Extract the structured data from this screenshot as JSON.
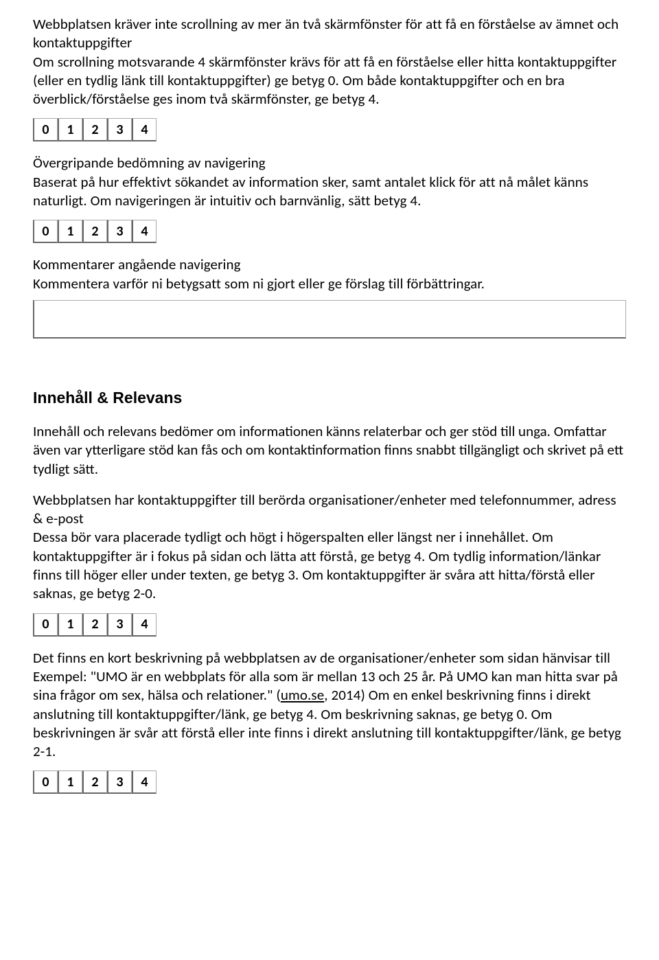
{
  "ratings": {
    "r0": "0",
    "r1": "1",
    "r2": "2",
    "r3": "3",
    "r4": "4"
  },
  "q1": {
    "title": "Webbplatsen kräver inte scrollning av mer än två skärmfönster för att få en förståelse av ämnet och kontaktuppgifter",
    "desc": "Om scrollning motsvarande 4 skärmfönster krävs för att få en förståelse eller hitta kontaktuppgifter (eller en tydlig länk till kontaktuppgifter) ge betyg 0. Om både kontaktuppgifter och en bra överblick/förståelse ges inom två skärmfönster, ge betyg 4."
  },
  "q2": {
    "title": "Övergripande bedömning av navigering",
    "desc": "Baserat på hur effektivt sökandet av information sker, samt antalet klick för att nå målet känns naturligt. Om navigeringen är intuitiv och barnvänlig, sätt betyg 4."
  },
  "q3": {
    "title": "Kommentarer angående navigering",
    "desc": "Kommentera varför ni betygsatt som ni gjort eller ge förslag till förbättringar."
  },
  "section2": {
    "heading": "Innehåll & Relevans",
    "intro": "Innehåll och relevans bedömer om informationen känns relaterbar och ger stöd till unga. Omfattar även var ytterligare stöd kan fås och om kontaktinformation finns snabbt tillgängligt och skrivet på ett tydligt sätt."
  },
  "q4": {
    "title": "Webbplatsen har kontaktuppgifter till berörda organisationer/enheter med telefonnummer, adress & e-post",
    "desc": "Dessa bör vara placerade tydligt och högt i högerspalten eller längst ner i innehållet. Om kontaktuppgifter är i fokus på sidan och lätta att förstå, ge betyg 4. Om tydlig information/länkar finns till höger eller under texten, ge betyg 3. Om kontaktuppgifter är svåra att hitta/förstå eller saknas, ge betyg 2-0."
  },
  "q5": {
    "title": "Det finns en kort beskrivning på webbplatsen av de organisationer/enheter som sidan hänvisar till",
    "desc_pre": "Exempel: \"UMO är en webbplats för alla som är mellan 13 och 25 år. På UMO kan man hitta svar på sina frågor om sex, hälsa och relationer.\" (",
    "link": "umo.se",
    "desc_post": ", 2014) Om en enkel beskrivning finns i direkt anslutning till kontaktuppgifter/länk, ge betyg 4. Om beskrivning saknas, ge betyg 0. Om beskrivningen är svår att förstå eller inte finns i direkt anslutning till kontaktuppgifter/länk, ge betyg 2-1."
  }
}
